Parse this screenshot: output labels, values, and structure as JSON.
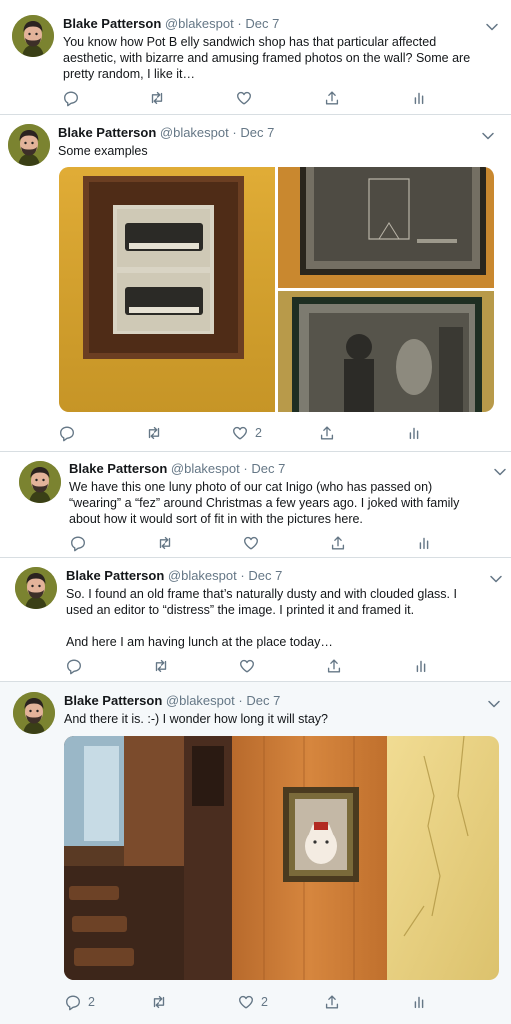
{
  "author": {
    "name": "Blake Patterson",
    "handle": "@blakespot",
    "dot": "·",
    "date": "Dec 7"
  },
  "tweets": [
    {
      "text": "You know how Pot B elly sandwich shop has that particular affected\naesthetic, with bizarre and amusing framed photos on the wall? Some are\npretty random, I like it…",
      "reply_count": "",
      "like_count": ""
    },
    {
      "text": "Some examples",
      "reply_count": "",
      "like_count": "2"
    },
    {
      "text": "We have this one luny photo of our cat Inigo (who has passed on)\n“wearing” a “fez” around Christmas a few years ago. I joked with family\nabout how it would sort of fit in with the pictures here.",
      "reply_count": "",
      "like_count": ""
    },
    {
      "text": "So. I found an old frame that’s naturally dusty and with clouded glass. I\nused an editor to “distress” the image. I printed it and framed it.\n\nAnd here I am having lunch at the place today…",
      "reply_count": "",
      "like_count": ""
    },
    {
      "text": "And there it is. :-) I wonder how long it will stay?",
      "reply_count": "2",
      "like_count": "2"
    }
  ],
  "icons": {
    "reply": "reply-icon",
    "retweet": "retweet-icon",
    "like": "heart-icon",
    "share": "share-icon",
    "analytics": "analytics-icon",
    "more": "chevron-down-icon"
  },
  "colors": {
    "text": "#14171a",
    "secondary": "#657786",
    "shaded_bg": "#f5f8fa"
  }
}
